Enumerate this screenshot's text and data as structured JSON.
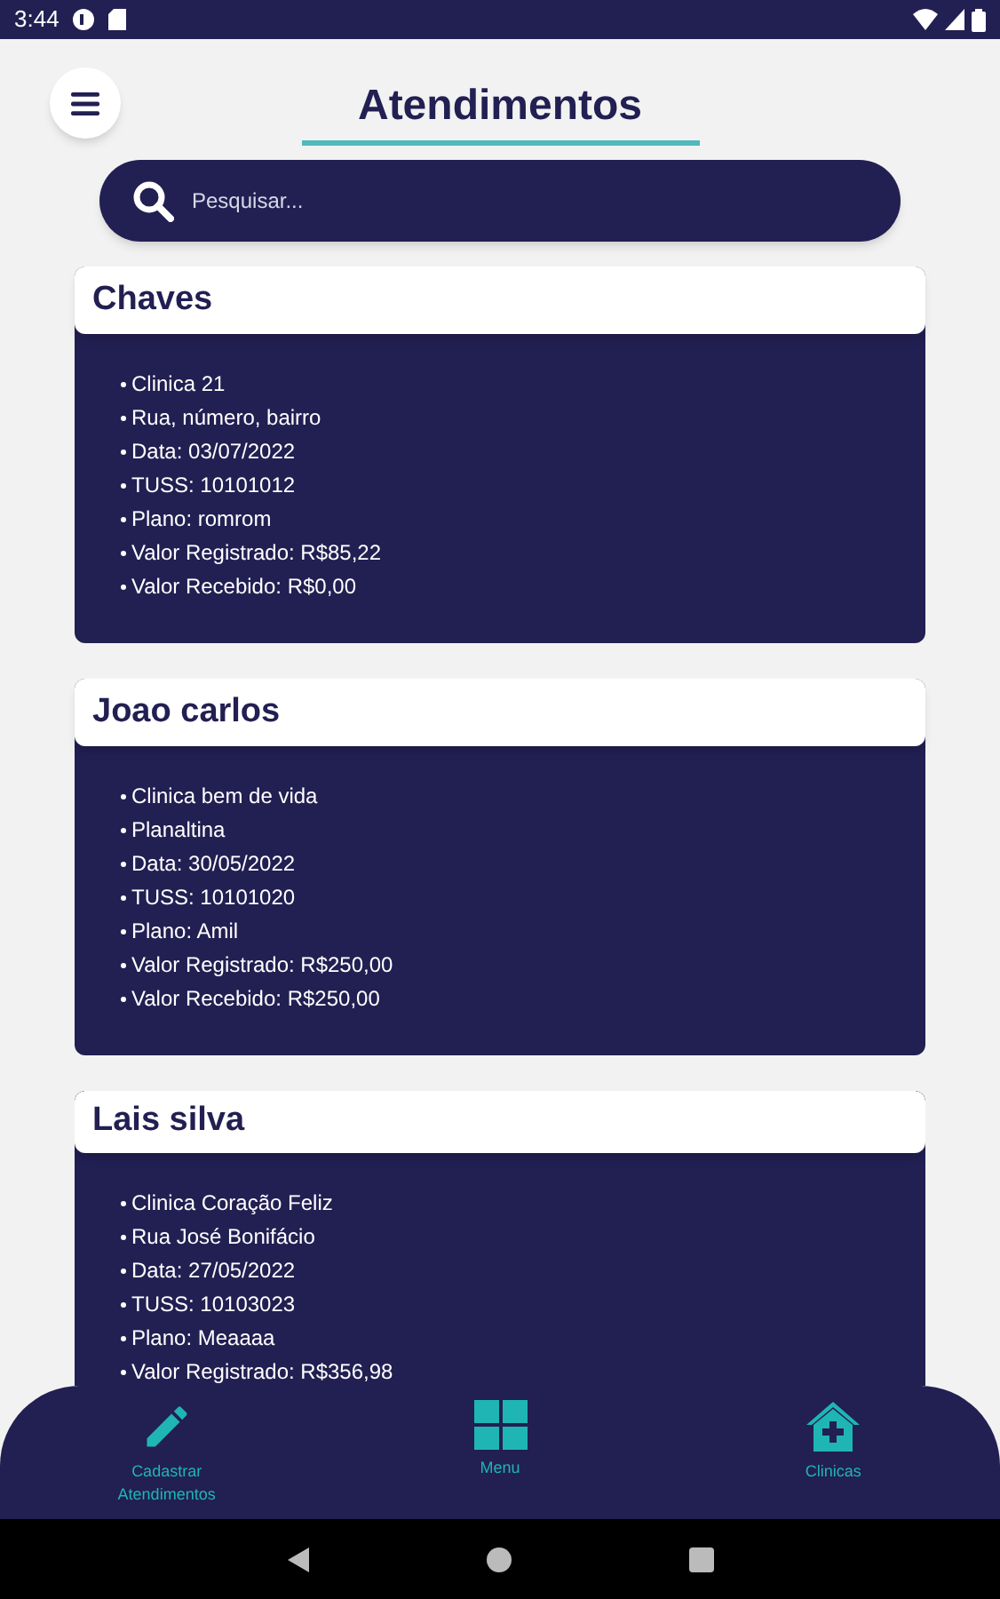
{
  "status_bar": {
    "time": "3:44"
  },
  "header": {
    "title": "Atendimentos"
  },
  "search": {
    "placeholder": "Pesquisar..."
  },
  "cards": [
    {
      "name": "Chaves",
      "items": [
        "Clinica 21",
        "Rua, número, bairro",
        "Data: 03/07/2022",
        "TUSS: 10101012",
        "Plano: romrom",
        "Valor Registrado: R$85,22",
        "Valor Recebido: R$0,00"
      ]
    },
    {
      "name": "Joao carlos",
      "items": [
        "Clinica bem de vida",
        "Planaltina",
        "Data: 30/05/2022",
        "TUSS: 10101020",
        "Plano: Amil",
        "Valor Registrado: R$250,00",
        "Valor Recebido: R$250,00"
      ]
    },
    {
      "name": "Lais silva",
      "items": [
        "Clinica Coração Feliz",
        "Rua José Bonifácio",
        "Data: 27/05/2022",
        "TUSS: 10103023",
        "Plano: Meaaaa",
        "Valor Registrado: R$356,98"
      ]
    }
  ],
  "bottom_nav": [
    {
      "kind": "pencil",
      "label": "Cadastrar Atendimentos"
    },
    {
      "kind": "grid",
      "label": "Menu"
    },
    {
      "kind": "clinic",
      "label": "Clinicas"
    }
  ]
}
